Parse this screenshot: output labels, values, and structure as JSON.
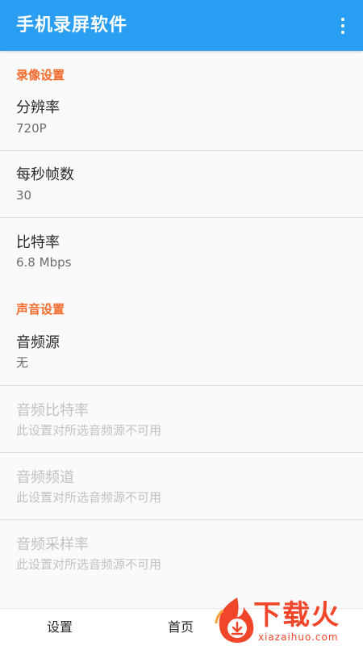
{
  "app_bar": {
    "title": "手机录屏软件",
    "overflow_icon": "more-vert-icon",
    "color": "#2a9ef2"
  },
  "sections": {
    "video": {
      "header": "录像设置",
      "items": [
        {
          "title": "分辨率",
          "summary": "720P"
        },
        {
          "title": "每秒帧数",
          "summary": "30"
        },
        {
          "title": "比特率",
          "summary": "6.8 Mbps"
        }
      ]
    },
    "audio": {
      "header": "声音设置",
      "items": [
        {
          "title": "音频源",
          "summary": "无"
        },
        {
          "title": "音频比特率",
          "summary": "此设置对所选音频源不可用"
        },
        {
          "title": "音频频道",
          "summary": "此设置对所选音频源不可用"
        },
        {
          "title": "音频采样率",
          "summary": "此设置对所选音频源不可用"
        }
      ]
    }
  },
  "bottom_nav": {
    "settings": "设置",
    "home": "首页"
  },
  "watermark": {
    "text": "下载火",
    "subtext": "xiazaihuo.com",
    "icon": "flame-download-icon",
    "color": "#f2462a"
  },
  "colors": {
    "section_header": "#f46a2a",
    "disabled_text": "#c2c2c2"
  }
}
